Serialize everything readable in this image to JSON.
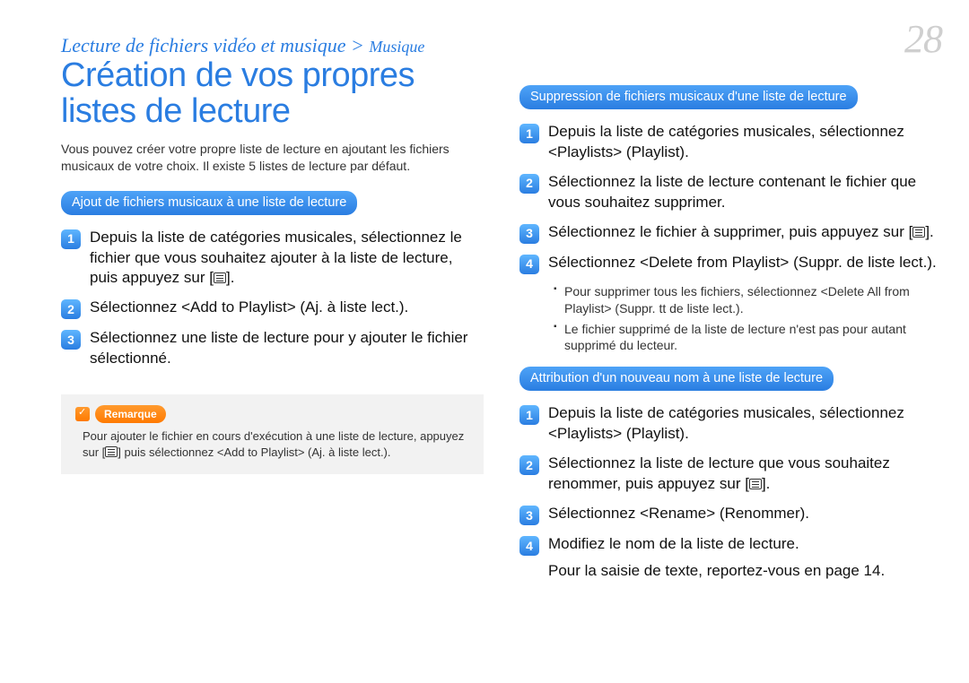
{
  "header": {
    "breadcrumb_main": "Lecture de fichiers vidéo et musique >",
    "breadcrumb_sub": "Musique",
    "page_number": "28"
  },
  "left": {
    "title": "Création de vos propres listes de lecture",
    "intro": "Vous pouvez créer votre propre liste de lecture en ajoutant les fichiers musicaux de votre choix. Il existe 5 listes de lecture par défaut.",
    "section_header": "Ajout de fichiers musicaux à une liste de lecture",
    "steps": [
      {
        "num": "1",
        "pre": "Depuis la liste de catégories musicales, sélectionnez le fichier que vous souhaitez ajouter à la liste de lecture, puis appuyez sur [",
        "post": "]."
      },
      {
        "num": "2",
        "text": "Sélectionnez <Add to Playlist> (Aj. à liste lect.)."
      },
      {
        "num": "3",
        "text": "Sélectionnez une liste de lecture pour y ajouter le fichier sélectionné."
      }
    ],
    "note_label": "Remarque",
    "note_pre": "Pour ajouter le fichier en cours d'exécution à une liste de lecture, appuyez sur [",
    "note_post": "] puis sélectionnez <Add to Playlist> (Aj. à liste lect.)."
  },
  "right": {
    "section1": {
      "header": "Suppression de fichiers musicaux d'une liste de lecture",
      "steps": [
        {
          "num": "1",
          "text": "Depuis la liste de catégories musicales, sélectionnez <Playlists> (Playlist)."
        },
        {
          "num": "2",
          "text": "Sélectionnez la liste de lecture contenant le fichier que vous souhaitez supprimer."
        },
        {
          "num": "3",
          "pre": "Sélectionnez le fichier à supprimer, puis appuyez sur [",
          "post": "]."
        },
        {
          "num": "4",
          "text": "Sélectionnez <Delete from Playlist> (Suppr. de liste lect.)."
        }
      ],
      "bullets": [
        "Pour supprimer tous les fichiers, sélectionnez <Delete All from Playlist> (Suppr. tt de liste lect.).",
        "Le fichier supprimé de la liste de lecture n'est pas pour autant supprimé du lecteur."
      ]
    },
    "section2": {
      "header": "Attribution d'un nouveau nom à une liste de lecture",
      "steps": [
        {
          "num": "1",
          "text": "Depuis la liste de catégories musicales, sélectionnez <Playlists> (Playlist)."
        },
        {
          "num": "2",
          "pre": "Sélectionnez la liste de lecture que vous souhaitez renommer, puis appuyez sur [",
          "post": "]."
        },
        {
          "num": "3",
          "text": "Sélectionnez <Rename> (Renommer)."
        },
        {
          "num": "4",
          "text": "Modifiez le nom de la liste de lecture."
        }
      ],
      "after": "Pour la saisie de texte, reportez-vous en page 14."
    }
  }
}
